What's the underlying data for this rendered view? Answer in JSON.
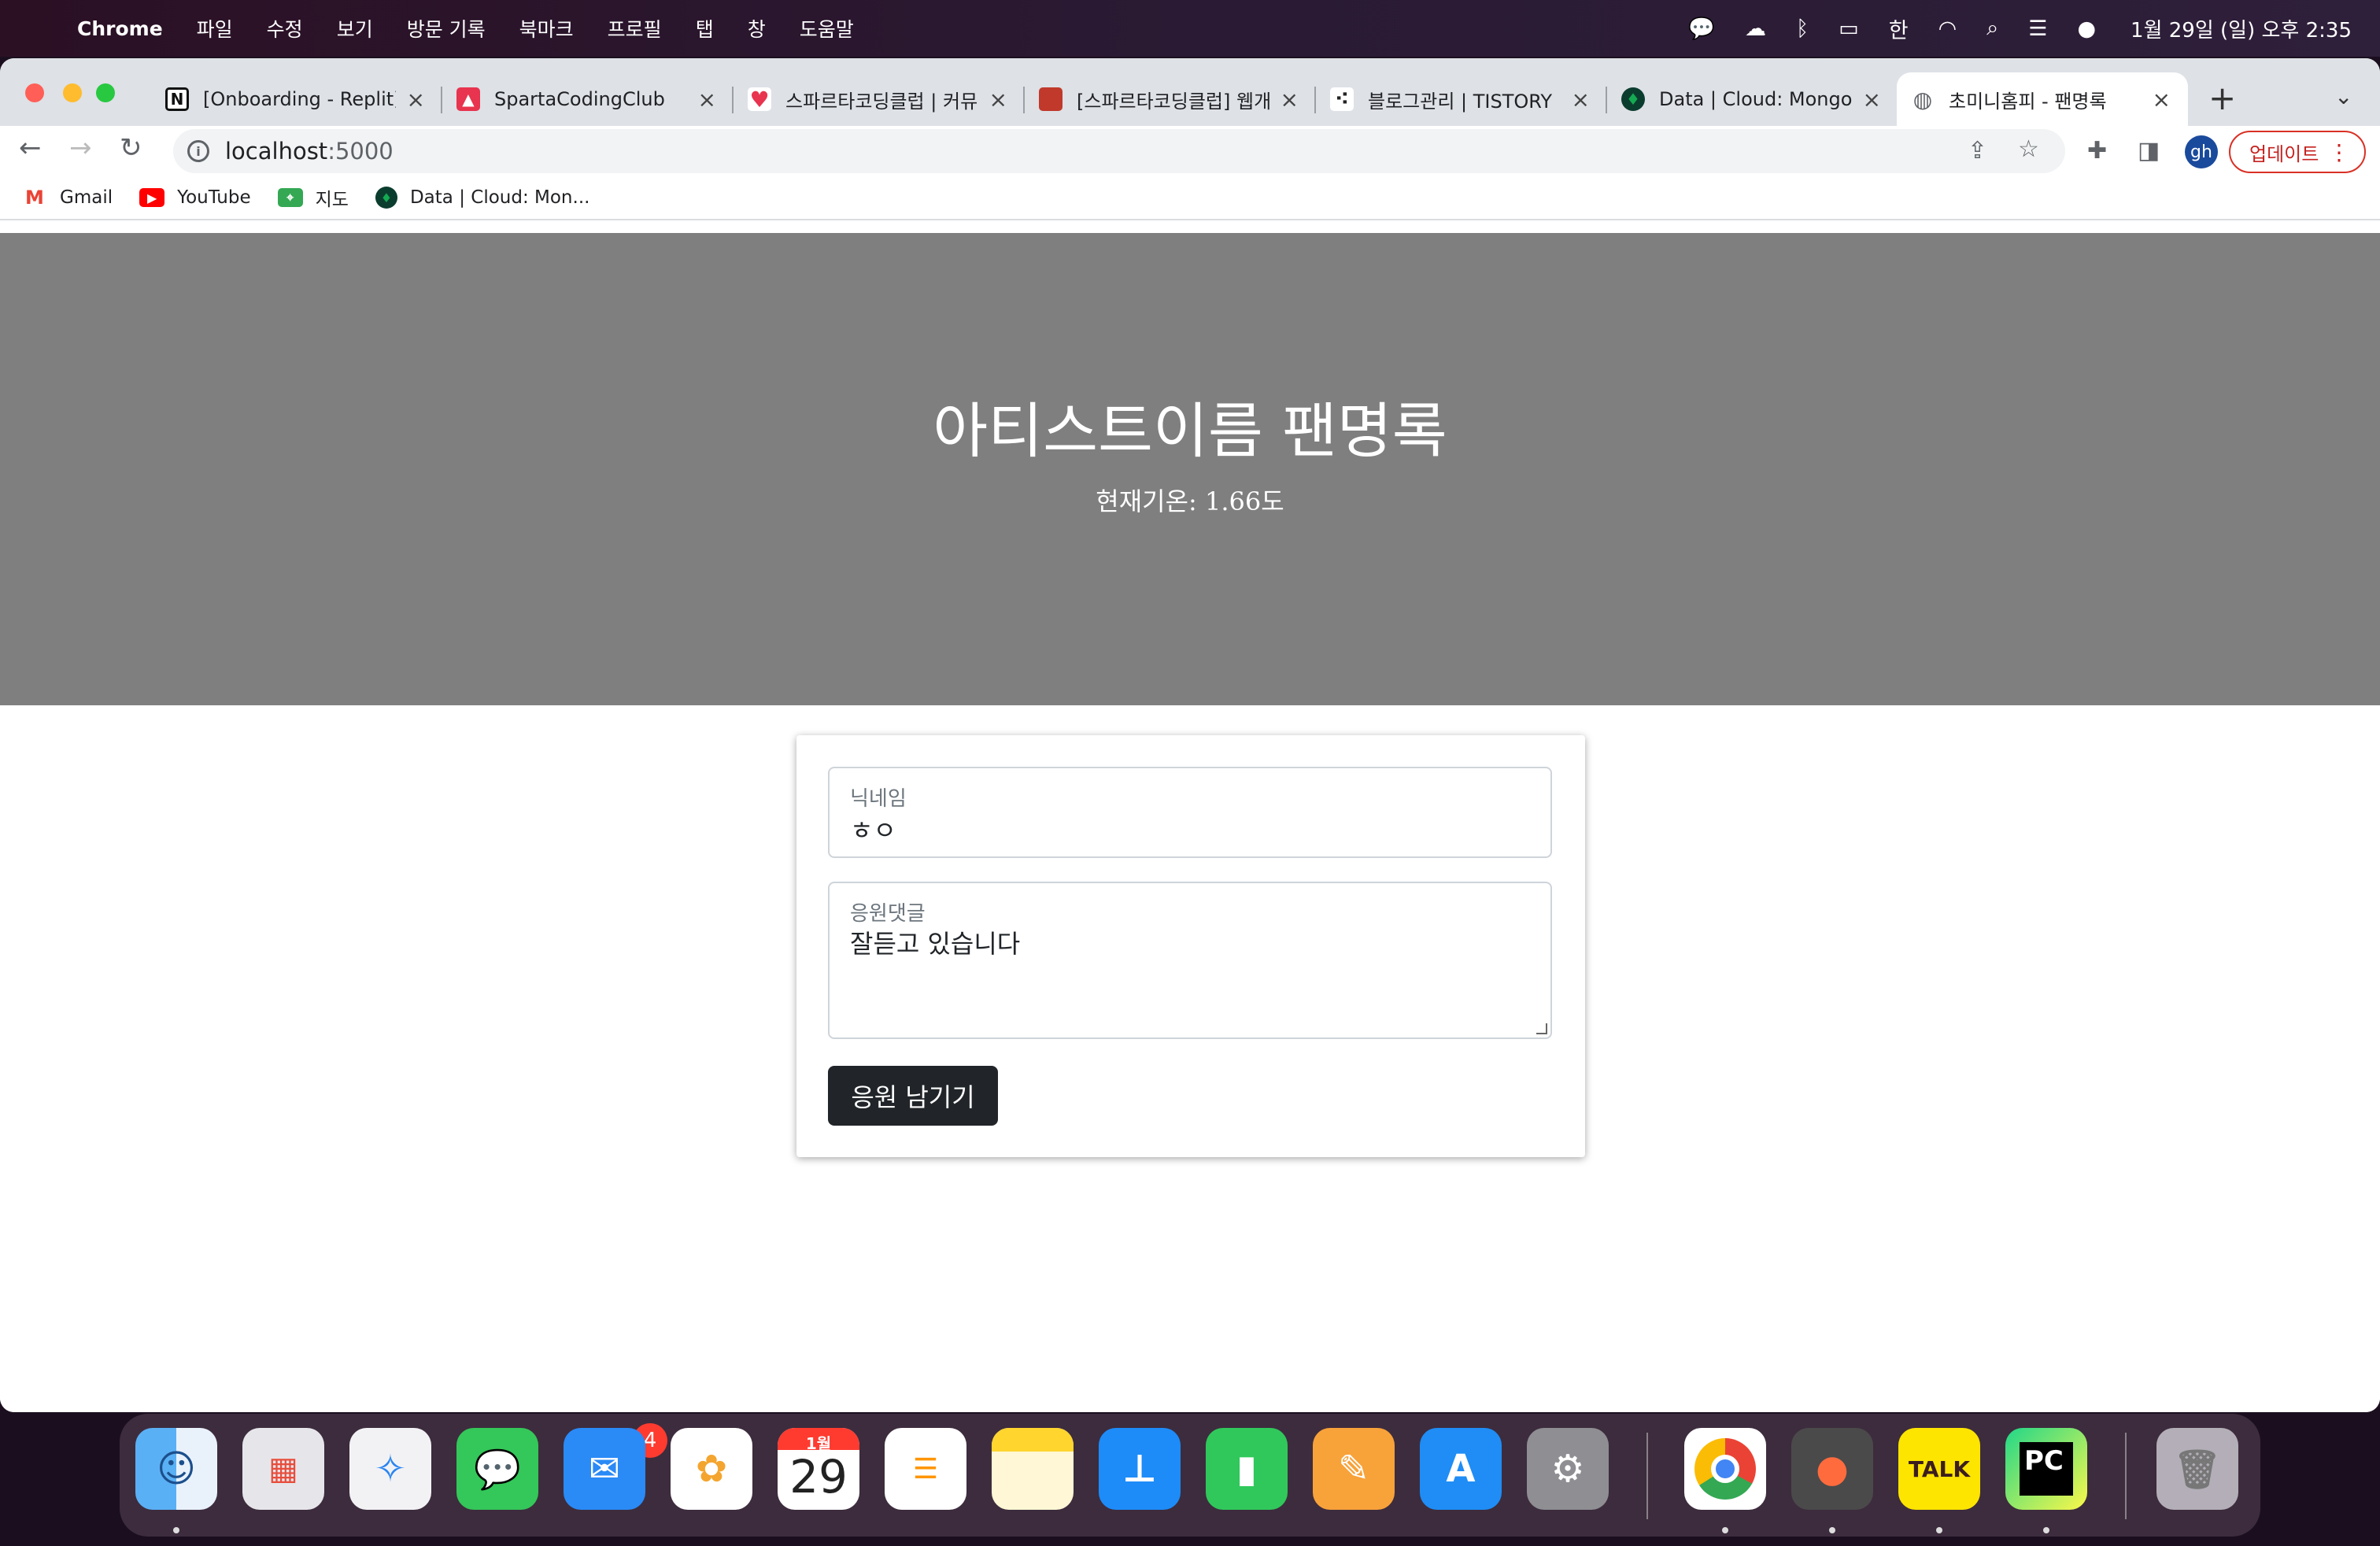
{
  "menubar": {
    "app_name": "Chrome",
    "items": [
      "파일",
      "수정",
      "보기",
      "방문 기록",
      "북마크",
      "프로필",
      "탭",
      "창",
      "도움말"
    ],
    "input_method": "한",
    "clock": "1월 29일 (일) 오후 2:35"
  },
  "tabs": [
    {
      "title": "[Onboarding - Replit]",
      "favicon": "notion-icon",
      "color": "#ffffff"
    },
    {
      "title": "SpartaCodingClub",
      "favicon": "sparta-icon",
      "color": "#e8344e"
    },
    {
      "title": "스파르타코딩클럽 | 커뮤니",
      "favicon": "heart-chat-icon",
      "color": "#e8344e"
    },
    {
      "title": "[스파르타코딩클럽] 웹개발",
      "favicon": "book-icon",
      "color": "#c0392b"
    },
    {
      "title": "블로그관리 | TISTORY",
      "favicon": "tistory-icon",
      "color": "#222222"
    },
    {
      "title": "Data | Cloud: MongoDB",
      "favicon": "mongodb-leaf-icon",
      "color": "#0b3d2e"
    },
    {
      "title": "초미니홈피 - 팬명록",
      "favicon": "globe-icon",
      "color": "#5f6368"
    }
  ],
  "toolbar": {
    "url_host": "localhost",
    "url_port": ":5000",
    "profile_initials": "gh",
    "update_label": "업데이트"
  },
  "bookmarks": [
    {
      "label": "Gmail",
      "icon": "gmail-icon"
    },
    {
      "label": "YouTube",
      "icon": "youtube-icon"
    },
    {
      "label": "지도",
      "icon": "maps-icon"
    },
    {
      "label": "Data | Cloud: Mon...",
      "icon": "mongodb-leaf-icon"
    }
  ],
  "hero": {
    "title": "아티스트이름 팬명록",
    "weather": "현재기온: 1.66도"
  },
  "form": {
    "nickname_label": "닉네임",
    "nickname_value": "ㅎㅇ",
    "comment_label": "응원댓글",
    "comment_value": "잘듣고 있습니다",
    "submit_label": "응원 남기기"
  },
  "dock": {
    "messages_badge": "4",
    "calendar_month": "1월",
    "calendar_day": "29",
    "apps": [
      "finder-icon",
      "launchpad-icon",
      "safari-icon",
      "messages-icon",
      "mail-icon",
      "photos-icon",
      "calendar-icon",
      "reminders-icon",
      "notes-icon",
      "keynote-icon",
      "numbers-icon",
      "pages-icon",
      "app-store-icon",
      "system-settings-icon",
      "chrome-icon",
      "food-app-icon",
      "kakaotalk-icon",
      "pycharm-icon",
      "trash-icon"
    ],
    "kakaotalk_label": "TALK",
    "pycharm_label": "PC"
  }
}
